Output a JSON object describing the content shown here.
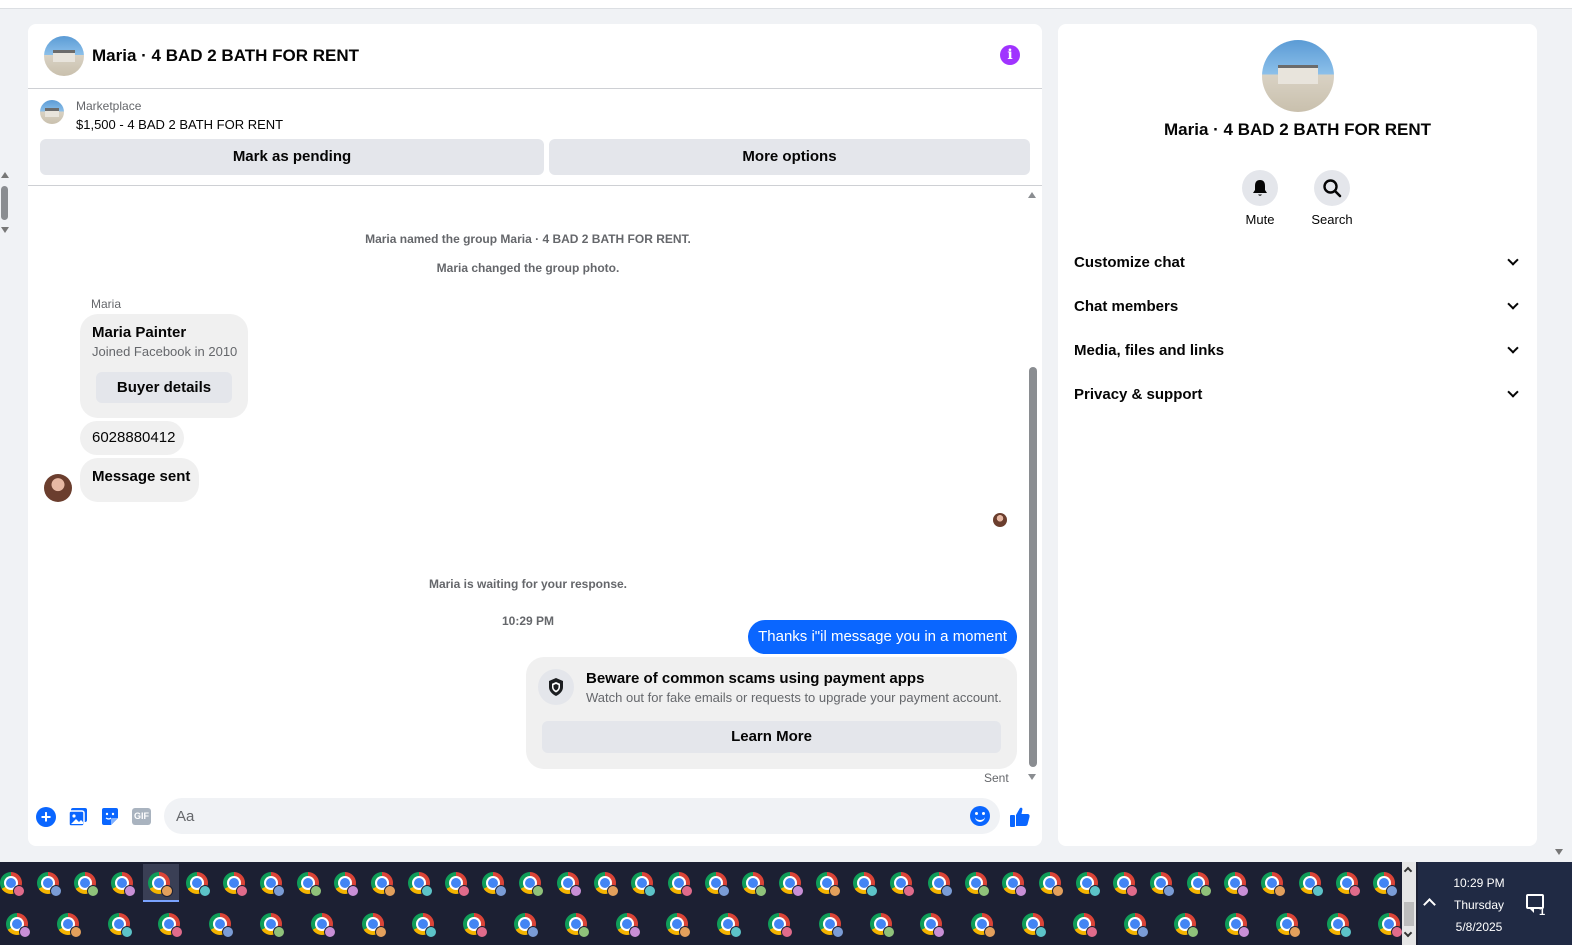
{
  "chat": {
    "title": "Maria · 4 BAD 2 BATH FOR RENT",
    "marketplace_label": "Marketplace",
    "listing": "$1,500 - 4 BAD 2 BATH FOR RENT",
    "mark_pending_label": "Mark as pending",
    "more_options_label": "More options"
  },
  "messages": {
    "system_named": "Maria named the group Maria · 4 BAD 2 BATH FOR RENT.",
    "system_photo": "Maria changed the group photo.",
    "sender_name": "Maria",
    "card_name": "Maria Painter",
    "card_joined": "Joined Facebook in 2010",
    "buyer_details_label": "Buyer details",
    "phone_message": "6028880412",
    "message_sent_text": "Message sent",
    "waiting_text": "Maria is waiting for your response.",
    "timestamp": "10:29 PM",
    "outgoing_message": "Thanks i\"il message you in a moment",
    "scam_title": "Beware of common scams using payment apps",
    "scam_subtitle": "Watch out for fake emails or requests to upgrade your payment account.",
    "learn_more_label": "Learn More",
    "sent_status": "Sent"
  },
  "composer": {
    "gif_label": "GIF",
    "placeholder": "Aa"
  },
  "sidebar": {
    "title": "Maria · 4 BAD 2 BATH FOR RENT",
    "mute_label": "Mute",
    "search_label": "Search",
    "sections": [
      {
        "label": "Customize chat"
      },
      {
        "label": "Chat members"
      },
      {
        "label": "Media, files and links"
      },
      {
        "label": "Privacy & support"
      }
    ]
  },
  "taskbar": {
    "time": "10:29 PM",
    "day": "Thursday",
    "date": "5/8/2025",
    "notification_count": "1"
  },
  "icons": {
    "info": "info-icon",
    "plus": "plus-icon",
    "photo": "photo-icon",
    "sticker": "sticker-icon",
    "gif": "gif-icon",
    "emoji": "emoji-icon",
    "like": "thumbs-up-icon",
    "mute": "bell-icon",
    "search": "search-icon",
    "shield": "shield-icon"
  },
  "colors": {
    "accent": "#0a66ff",
    "info": "#a033ff",
    "taskbar": "#1c2033"
  }
}
